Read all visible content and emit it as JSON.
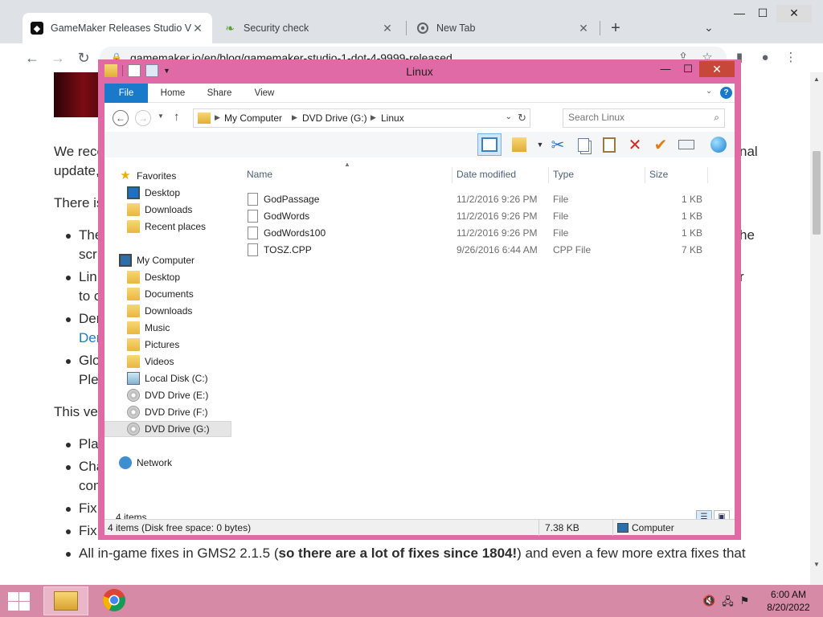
{
  "browser": {
    "tabs": [
      {
        "title": "GameMaker Releases Studio Version",
        "favicon": "gamemaker-icon"
      },
      {
        "title": "Security check",
        "favicon": "leaf-icon"
      },
      {
        "title": "New Tab",
        "favicon": "chrome-icon"
      }
    ],
    "new_tab_label": "+",
    "url": "gamemaker.io/en/blog/gamemaker-studio-1-dot-4-9999-released"
  },
  "page": {
    "lines": [
      {
        "text": "We rece",
        "right": "nal"
      },
      {
        "text": "update,"
      },
      {
        "text": "There is"
      }
    ],
    "bullets": [
      {
        "lines": [
          "The",
          "scr"
        ],
        "right": "he"
      },
      {
        "lines": [
          "Lin",
          "to c"
        ],
        "right": "r"
      },
      {
        "lines": [
          "Der",
          "Der"
        ]
      },
      {
        "lines": [
          "Glo",
          "Ple"
        ]
      }
    ],
    "this_version": "This ver",
    "bullets2": [
      {
        "lines": [
          "Pla"
        ]
      },
      {
        "lines": [
          "Cha",
          "con"
        ]
      },
      {
        "lines": [
          "Fix"
        ]
      },
      {
        "lines": [
          "Fix"
        ]
      }
    ],
    "last_bullet_pre": "All in-game fixes in GMS2 2.1.5 (",
    "last_bullet_bold": "so there are a lot of fixes since 1804!",
    "last_bullet_post": ") and even a few more extra fixes that"
  },
  "explorer": {
    "title": "Linux",
    "ribbon_tabs": [
      "File",
      "Home",
      "Share",
      "View"
    ],
    "breadcrumb": [
      "My Computer",
      "DVD Drive (G:)",
      "Linux"
    ],
    "search_placeholder": "Search Linux",
    "nav": {
      "favorites_header": "Favorites",
      "favorites": [
        "Desktop",
        "Downloads",
        "Recent places"
      ],
      "computer_header": "My Computer",
      "computer": [
        "Desktop",
        "Documents",
        "Downloads",
        "Music",
        "Pictures",
        "Videos",
        "Local Disk (C:)",
        "DVD Drive (E:)",
        "DVD Drive (F:)",
        "DVD Drive (G:)"
      ],
      "network": "Network"
    },
    "columns": [
      "Name",
      "Date modified",
      "Type",
      "Size"
    ],
    "files": [
      {
        "name": "GodPassage",
        "date": "11/2/2016 9:26 PM",
        "type": "File",
        "size": "1 KB"
      },
      {
        "name": "GodWords",
        "date": "11/2/2016 9:26 PM",
        "type": "File",
        "size": "1 KB"
      },
      {
        "name": "GodWords100",
        "date": "11/2/2016 9:26 PM",
        "type": "File",
        "size": "1 KB"
      },
      {
        "name": "TOSZ.CPP",
        "date": "9/26/2016 6:44 AM",
        "type": "CPP File",
        "size": "7 KB"
      }
    ],
    "item_count": "4 items",
    "status_left": "4 items (Disk free space: 0 bytes)",
    "status_size": "7.38 KB",
    "status_location": "Computer"
  },
  "taskbar": {
    "time": "6:00 AM",
    "date": "8/20/2022"
  }
}
